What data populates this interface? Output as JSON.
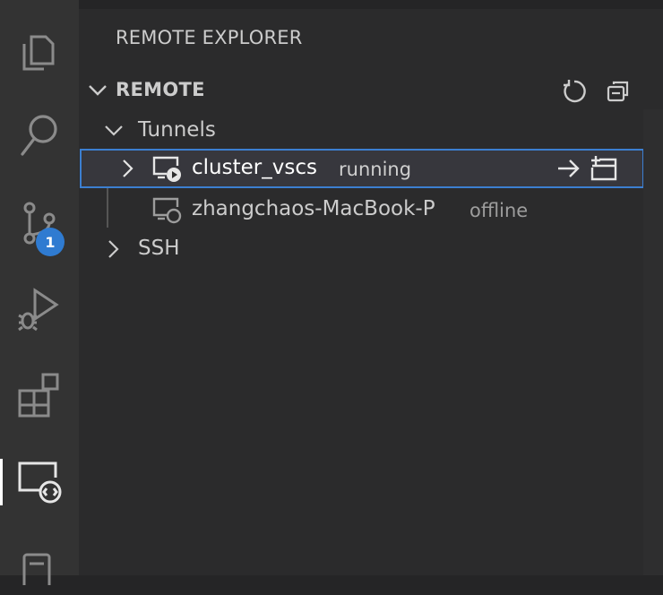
{
  "activity_bar": {
    "items": [
      {
        "icon": "files-icon"
      },
      {
        "icon": "search-icon"
      },
      {
        "icon": "source-control-icon",
        "badge": "1"
      },
      {
        "icon": "run-debug-icon"
      },
      {
        "icon": "extensions-icon"
      },
      {
        "icon": "remote-explorer-icon",
        "active": true
      },
      {
        "icon": "testing-icon"
      }
    ]
  },
  "sidebar": {
    "title": "REMOTE EXPLORER",
    "section": {
      "title": "REMOTE",
      "actions": [
        "refresh-icon",
        "collapse-all-icon"
      ]
    },
    "tree": {
      "tunnels": {
        "label": "Tunnels",
        "items": [
          {
            "label": "cluster_vscs",
            "description": "running",
            "selected": true,
            "actions": [
              "connect-in-current-window-icon",
              "connect-in-new-window-icon"
            ]
          },
          {
            "label": "zhangchaos-MacBook-P",
            "description": "offline"
          }
        ]
      },
      "ssh": {
        "label": "SSH"
      }
    }
  },
  "colors": {
    "badge": "#2f7bd1",
    "selection_border": "#3c7fd1",
    "foreground": "#cccccc",
    "description": "#9d9d9d"
  }
}
